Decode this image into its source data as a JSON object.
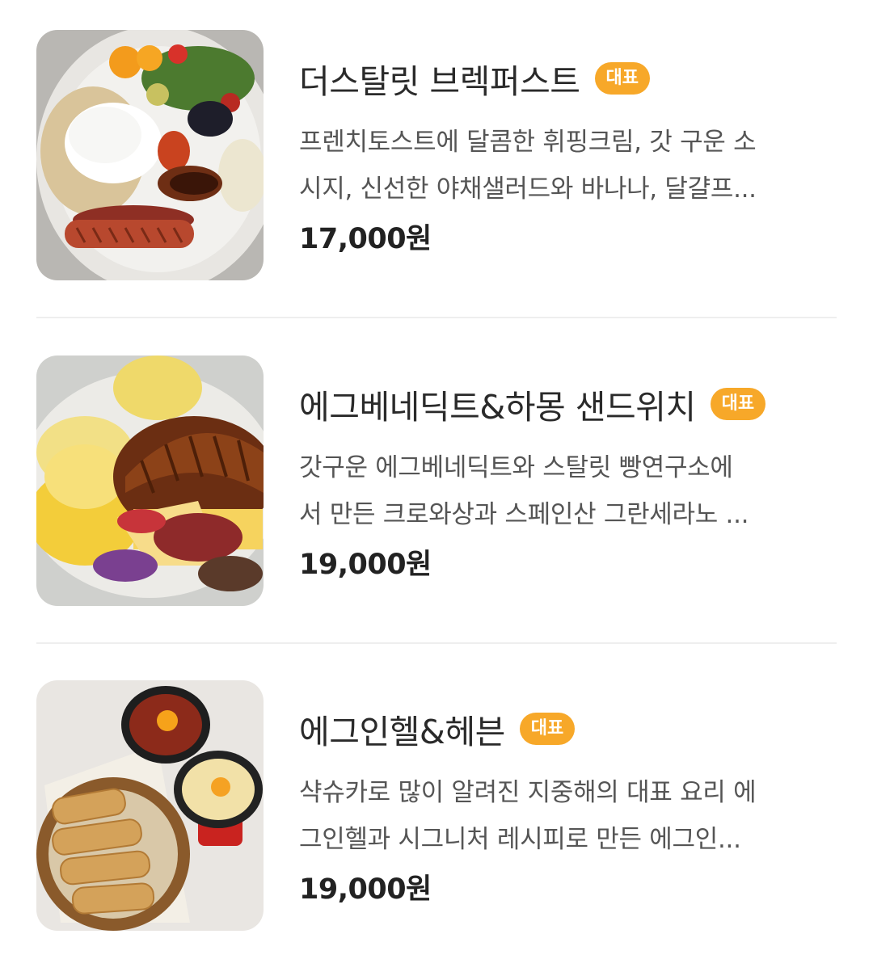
{
  "menu": {
    "items": [
      {
        "title": "더스탈릿 브렉퍼스트",
        "badge": "대표",
        "desc_line1": "프렌치토스트에 달콤한 휘핑크림, 갓 구운 소",
        "desc_line2": "시지, 신선한 야채샐러드와 바나나, 달걀프...",
        "price": "17,000원"
      },
      {
        "title": "에그베네딕트&하몽 샌드위치",
        "badge": "대표",
        "desc_line1": "갓구운 에그베네딕트와 스탈릿 빵연구소에",
        "desc_line2": "서 만든 크로와상과 스페인산 그란세라노 ...",
        "price": "19,000원"
      },
      {
        "title": "에그인헬&헤븐",
        "badge": "대표",
        "desc_line1": "샥슈카로 많이 알려진 지중해의 대표 요리 에",
        "desc_line2": "그인헬과 시그니처 레시피로 만든 에그인...",
        "price": "19,000원"
      }
    ]
  },
  "colors": {
    "badge": "#f7a829",
    "title": "#2a2a2a",
    "desc": "#555555",
    "divider": "#eeeeee"
  }
}
